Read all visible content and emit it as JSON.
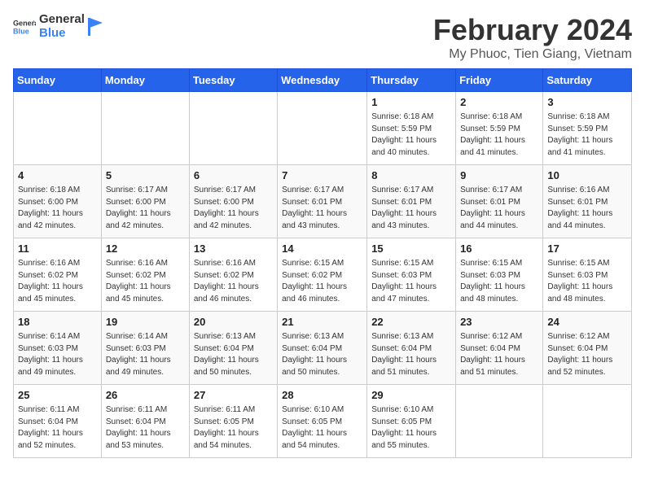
{
  "header": {
    "logo_general": "General",
    "logo_blue": "Blue",
    "title": "February 2024",
    "subtitle": "My Phuoc, Tien Giang, Vietnam"
  },
  "weekdays": [
    "Sunday",
    "Monday",
    "Tuesday",
    "Wednesday",
    "Thursday",
    "Friday",
    "Saturday"
  ],
  "weeks": [
    [
      {
        "day": "",
        "info": ""
      },
      {
        "day": "",
        "info": ""
      },
      {
        "day": "",
        "info": ""
      },
      {
        "day": "",
        "info": ""
      },
      {
        "day": "1",
        "info": "Sunrise: 6:18 AM\nSunset: 5:59 PM\nDaylight: 11 hours\nand 40 minutes."
      },
      {
        "day": "2",
        "info": "Sunrise: 6:18 AM\nSunset: 5:59 PM\nDaylight: 11 hours\nand 41 minutes."
      },
      {
        "day": "3",
        "info": "Sunrise: 6:18 AM\nSunset: 5:59 PM\nDaylight: 11 hours\nand 41 minutes."
      }
    ],
    [
      {
        "day": "4",
        "info": "Sunrise: 6:18 AM\nSunset: 6:00 PM\nDaylight: 11 hours\nand 42 minutes."
      },
      {
        "day": "5",
        "info": "Sunrise: 6:17 AM\nSunset: 6:00 PM\nDaylight: 11 hours\nand 42 minutes."
      },
      {
        "day": "6",
        "info": "Sunrise: 6:17 AM\nSunset: 6:00 PM\nDaylight: 11 hours\nand 42 minutes."
      },
      {
        "day": "7",
        "info": "Sunrise: 6:17 AM\nSunset: 6:01 PM\nDaylight: 11 hours\nand 43 minutes."
      },
      {
        "day": "8",
        "info": "Sunrise: 6:17 AM\nSunset: 6:01 PM\nDaylight: 11 hours\nand 43 minutes."
      },
      {
        "day": "9",
        "info": "Sunrise: 6:17 AM\nSunset: 6:01 PM\nDaylight: 11 hours\nand 44 minutes."
      },
      {
        "day": "10",
        "info": "Sunrise: 6:16 AM\nSunset: 6:01 PM\nDaylight: 11 hours\nand 44 minutes."
      }
    ],
    [
      {
        "day": "11",
        "info": "Sunrise: 6:16 AM\nSunset: 6:02 PM\nDaylight: 11 hours\nand 45 minutes."
      },
      {
        "day": "12",
        "info": "Sunrise: 6:16 AM\nSunset: 6:02 PM\nDaylight: 11 hours\nand 45 minutes."
      },
      {
        "day": "13",
        "info": "Sunrise: 6:16 AM\nSunset: 6:02 PM\nDaylight: 11 hours\nand 46 minutes."
      },
      {
        "day": "14",
        "info": "Sunrise: 6:15 AM\nSunset: 6:02 PM\nDaylight: 11 hours\nand 46 minutes."
      },
      {
        "day": "15",
        "info": "Sunrise: 6:15 AM\nSunset: 6:03 PM\nDaylight: 11 hours\nand 47 minutes."
      },
      {
        "day": "16",
        "info": "Sunrise: 6:15 AM\nSunset: 6:03 PM\nDaylight: 11 hours\nand 48 minutes."
      },
      {
        "day": "17",
        "info": "Sunrise: 6:15 AM\nSunset: 6:03 PM\nDaylight: 11 hours\nand 48 minutes."
      }
    ],
    [
      {
        "day": "18",
        "info": "Sunrise: 6:14 AM\nSunset: 6:03 PM\nDaylight: 11 hours\nand 49 minutes."
      },
      {
        "day": "19",
        "info": "Sunrise: 6:14 AM\nSunset: 6:03 PM\nDaylight: 11 hours\nand 49 minutes."
      },
      {
        "day": "20",
        "info": "Sunrise: 6:13 AM\nSunset: 6:04 PM\nDaylight: 11 hours\nand 50 minutes."
      },
      {
        "day": "21",
        "info": "Sunrise: 6:13 AM\nSunset: 6:04 PM\nDaylight: 11 hours\nand 50 minutes."
      },
      {
        "day": "22",
        "info": "Sunrise: 6:13 AM\nSunset: 6:04 PM\nDaylight: 11 hours\nand 51 minutes."
      },
      {
        "day": "23",
        "info": "Sunrise: 6:12 AM\nSunset: 6:04 PM\nDaylight: 11 hours\nand 51 minutes."
      },
      {
        "day": "24",
        "info": "Sunrise: 6:12 AM\nSunset: 6:04 PM\nDaylight: 11 hours\nand 52 minutes."
      }
    ],
    [
      {
        "day": "25",
        "info": "Sunrise: 6:11 AM\nSunset: 6:04 PM\nDaylight: 11 hours\nand 52 minutes."
      },
      {
        "day": "26",
        "info": "Sunrise: 6:11 AM\nSunset: 6:04 PM\nDaylight: 11 hours\nand 53 minutes."
      },
      {
        "day": "27",
        "info": "Sunrise: 6:11 AM\nSunset: 6:05 PM\nDaylight: 11 hours\nand 54 minutes."
      },
      {
        "day": "28",
        "info": "Sunrise: 6:10 AM\nSunset: 6:05 PM\nDaylight: 11 hours\nand 54 minutes."
      },
      {
        "day": "29",
        "info": "Sunrise: 6:10 AM\nSunset: 6:05 PM\nDaylight: 11 hours\nand 55 minutes."
      },
      {
        "day": "",
        "info": ""
      },
      {
        "day": "",
        "info": ""
      }
    ]
  ]
}
